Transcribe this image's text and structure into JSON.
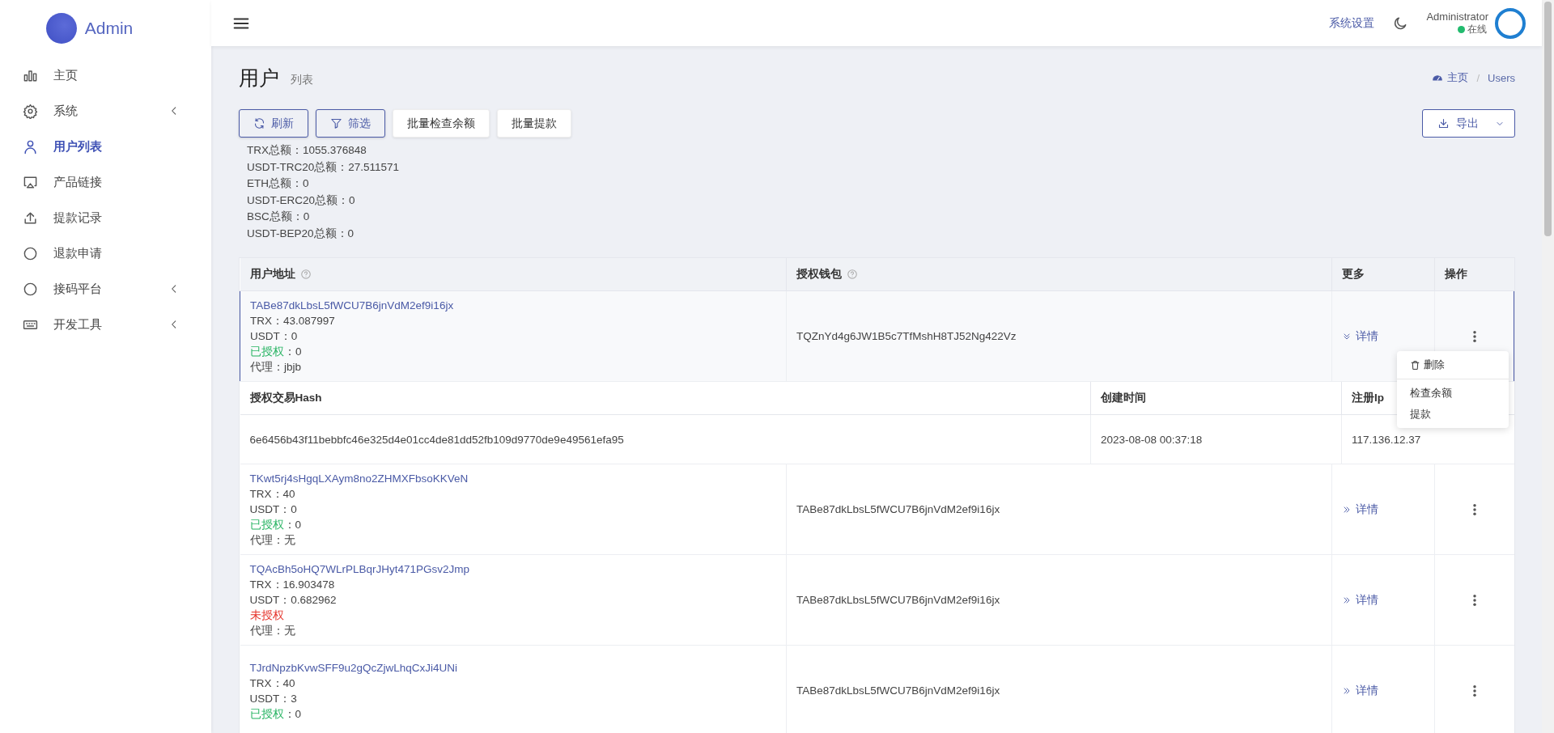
{
  "sidebar": {
    "brand": "Admin",
    "items": [
      {
        "label": "主页",
        "selected": false,
        "has_submenu": false
      },
      {
        "label": "系统",
        "selected": false,
        "has_submenu": true
      },
      {
        "label": "用户列表",
        "selected": true,
        "has_submenu": false
      },
      {
        "label": "产品链接",
        "selected": false,
        "has_submenu": false
      },
      {
        "label": "提款记录",
        "selected": false,
        "has_submenu": false
      },
      {
        "label": "退款申请",
        "selected": false,
        "has_submenu": false
      },
      {
        "label": "接码平台",
        "selected": false,
        "has_submenu": true
      },
      {
        "label": "开发工具",
        "selected": false,
        "has_submenu": true
      }
    ]
  },
  "header": {
    "settings_link": "系统设置",
    "user_name": "Administrator",
    "status": "在线",
    "online": true
  },
  "page": {
    "title": "用户",
    "subtitle": "列表",
    "breadcrumb": [
      "主页",
      "Users"
    ],
    "breadcrumb_separator": "/"
  },
  "toolbar": {
    "buttons": [
      {
        "label": "刷新",
        "kind": "outline"
      },
      {
        "label": "筛选",
        "kind": "outline"
      },
      {
        "label": "批量检查余额",
        "kind": "plain"
      },
      {
        "label": "批量提款",
        "kind": "plain"
      }
    ],
    "export": "导出"
  },
  "totals": [
    "TRX总额：1055.376848",
    "USDT-TRC20总额：27.511571",
    "ETH总额：0",
    "USDT-ERC20总额：0",
    "BSC总额：0",
    "USDT-BEP20总额：0"
  ],
  "table": {
    "columns": [
      {
        "label": "用户地址",
        "help": true
      },
      {
        "label": "授权钱包",
        "help": true
      },
      {
        "label": "更多",
        "help": false
      },
      {
        "label": "操作",
        "help": false
      }
    ],
    "rows": [
      {
        "address": "TABe87dkLbsL5fWCU7B6jnVdM2ef9i16jx",
        "lines": [
          "TRX：43.087997",
          "USDT：0"
        ],
        "auth_label": "已授权",
        "auth_value": "：0",
        "authorized": true,
        "agent": "代理：jbjb",
        "wallet": "TQZnYd4g6JW1B5c7TfMshH8TJ52Ng422Vz",
        "details": "详情",
        "expanded": true,
        "detail": {
          "columns": [
            "授权交易Hash",
            "创建时间",
            "注册Ip"
          ],
          "values": [
            "6e6456b43f11bebbfc46e325d4e01cc4de81dd52fb109d9770de9e49561efa95",
            "2023-08-08 00:37:18",
            "117.136.12.37"
          ]
        }
      },
      {
        "address": "TKwt5rj4sHgqLXAym8no2ZHMXFbsoKKVeN",
        "lines": [
          "TRX：40",
          "USDT：0"
        ],
        "auth_label": "已授权",
        "auth_value": "：0",
        "authorized": true,
        "agent": "代理：无",
        "wallet": "TABe87dkLbsL5fWCU7B6jnVdM2ef9i16jx",
        "details": "详情",
        "expanded": false
      },
      {
        "address": "TQAcBh5oHQ7WLrPLBqrJHyt471PGsv2Jmp",
        "lines": [
          "TRX：16.903478",
          "USDT：0.682962"
        ],
        "auth_label": "未授权",
        "authorized": false,
        "agent": "代理：无",
        "wallet": "TABe87dkLbsL5fWCU7B6jnVdM2ef9i16jx",
        "details": "详情",
        "expanded": false
      },
      {
        "address": "TJrdNpzbKvwSFF9u2gQcZjwLhqCxJi4UNi",
        "lines": [
          "TRX：40",
          "USDT：3"
        ],
        "auth_label": "已授权",
        "auth_value": "：0",
        "authorized": true,
        "wallet": "TABe87dkLbsL5fWCU7B6jnVdM2ef9i16jx",
        "details": "详情",
        "expanded": false
      }
    ]
  },
  "row_menu": {
    "groups": [
      [
        "删除"
      ],
      [
        "检查余额",
        "提款"
      ]
    ]
  }
}
